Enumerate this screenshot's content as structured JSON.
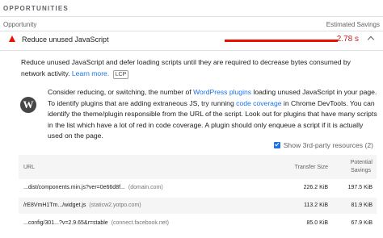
{
  "section": {
    "title": "OPPORTUNITIES"
  },
  "columns": {
    "opportunity": "Opportunity",
    "savings": "Estimated Savings"
  },
  "audit": {
    "title": "Reduce unused JavaScript",
    "savings": "2.78 s",
    "savings_color": "#eb0f00",
    "icon": "warning-triangle-icon"
  },
  "description": {
    "text": "Reduce unused JavaScript and defer loading scripts until they are required to decrease bytes consumed by network activity.",
    "learn_more": "Learn more.",
    "badge": "LCP"
  },
  "plugin_note": {
    "icon": "wordpress-logo-icon",
    "logo_letter": "W",
    "part1": "Consider reducing, or switching, the number of ",
    "link1": "WordPress plugins",
    "part2": " loading unused JavaScript in your page. To identify plugins that are adding extraneous JS, try running ",
    "link2": "code coverage",
    "part3": " in Chrome DevTools. You can identify the theme/plugin responsible from the URL of the script. Look out for plugins that have many scripts in the list which have a lot of red in code coverage. A plugin should only enqueue a script if it is actually used on the page."
  },
  "third_party": {
    "label": "Show 3rd-party resources (2)",
    "checked": true
  },
  "table": {
    "headers": {
      "url": "URL",
      "transfer": "Transfer Size",
      "savings_line1": "Potential",
      "savings_line2": "Savings"
    },
    "rows": [
      {
        "url": "...dist/components.min.js?ver=0e66d8f...",
        "host": "(domain.com)",
        "transfer": "226.2 KiB",
        "savings": "197.5 KiB"
      },
      {
        "url": "/rE8VmH1Tm.../widget.js",
        "host": "(staticw2.yotpo.com)",
        "transfer": "113.2 KiB",
        "savings": "81.9 KiB"
      },
      {
        "url": "...config/301...?v=2.9.65&r=stable",
        "host": "(connect.facebook.net)",
        "transfer": "85.0 KiB",
        "savings": "67.9 KiB"
      }
    ]
  }
}
